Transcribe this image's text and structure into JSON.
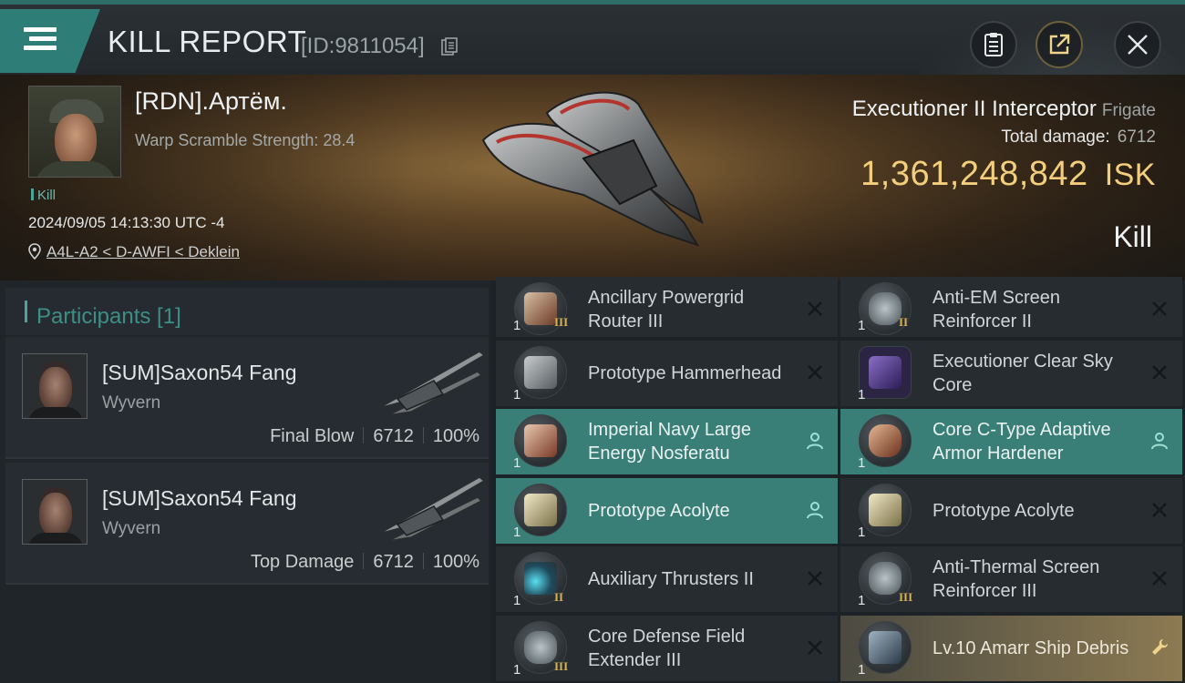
{
  "header": {
    "title": "KILL REPORT",
    "id_text": "[ID:9811054]",
    "buttons": [
      "menu-icon",
      "report-icon",
      "share-icon",
      "close-icon"
    ]
  },
  "victim": {
    "name": "[RDN].Артём.",
    "warp_scramble": "Warp Scramble Strength: 28.4",
    "kill_tag": "Kill",
    "timestamp": "2024/09/05 14:13:30 UTC -4",
    "location": "A4L-A2 < D-AWFI < Deklein"
  },
  "ship": {
    "name": "Executioner II Interceptor",
    "class": "Frigate",
    "total_damage_label": "Total damage:",
    "total_damage": "6712",
    "isk_value": "1,361,248,842",
    "isk_unit": "ISK",
    "result": "Kill"
  },
  "participants": {
    "title": "Participants [1]",
    "items": [
      {
        "name": "[SUM]Saxon54 Fang",
        "ship": "Wyvern",
        "role": "Final Blow",
        "damage": "6712",
        "percent": "100%"
      },
      {
        "name": "[SUM]Saxon54 Fang",
        "ship": "Wyvern",
        "role": "Top Damage",
        "damage": "6712",
        "percent": "100%"
      }
    ]
  },
  "modules": [
    {
      "name": "Ancillary Powergrid Router III",
      "qty": "1",
      "tier": "III",
      "state": "destroyed"
    },
    {
      "name": "Anti-EM Screen Reinforcer II",
      "qty": "1",
      "tier": "II",
      "state": "destroyed"
    },
    {
      "name": "Prototype Hammerhead",
      "qty": "1",
      "tier": "",
      "state": "destroyed"
    },
    {
      "name": "Executioner Clear Sky Core",
      "qty": "1",
      "tier": "",
      "state": "destroyed"
    },
    {
      "name": "Imperial Navy Large Energy Nosferatu",
      "qty": "1",
      "tier": "",
      "state": "dropped"
    },
    {
      "name": "Core C-Type Adaptive Armor Hardener",
      "qty": "1",
      "tier": "",
      "state": "dropped"
    },
    {
      "name": "Prototype  Acolyte",
      "qty": "1",
      "tier": "",
      "state": "dropped"
    },
    {
      "name": "Prototype  Acolyte",
      "qty": "1",
      "tier": "",
      "state": "destroyed"
    },
    {
      "name": "Auxiliary Thrusters II",
      "qty": "1",
      "tier": "II",
      "state": "destroyed"
    },
    {
      "name": "Anti-Thermal Screen Reinforcer III",
      "qty": "1",
      "tier": "III",
      "state": "destroyed"
    },
    {
      "name": "Core Defense Field Extender III",
      "qty": "1",
      "tier": "III",
      "state": "destroyed"
    },
    {
      "name": "Lv.10 Amarr Ship Debris",
      "qty": "1",
      "tier": "",
      "state": "salvage"
    }
  ],
  "colors": {
    "accent_teal": "#2e7d76",
    "isk_gold": "#f3cf7d",
    "dropped_bg": "#3a7f77",
    "salvage_bg": "#8c7a52"
  }
}
